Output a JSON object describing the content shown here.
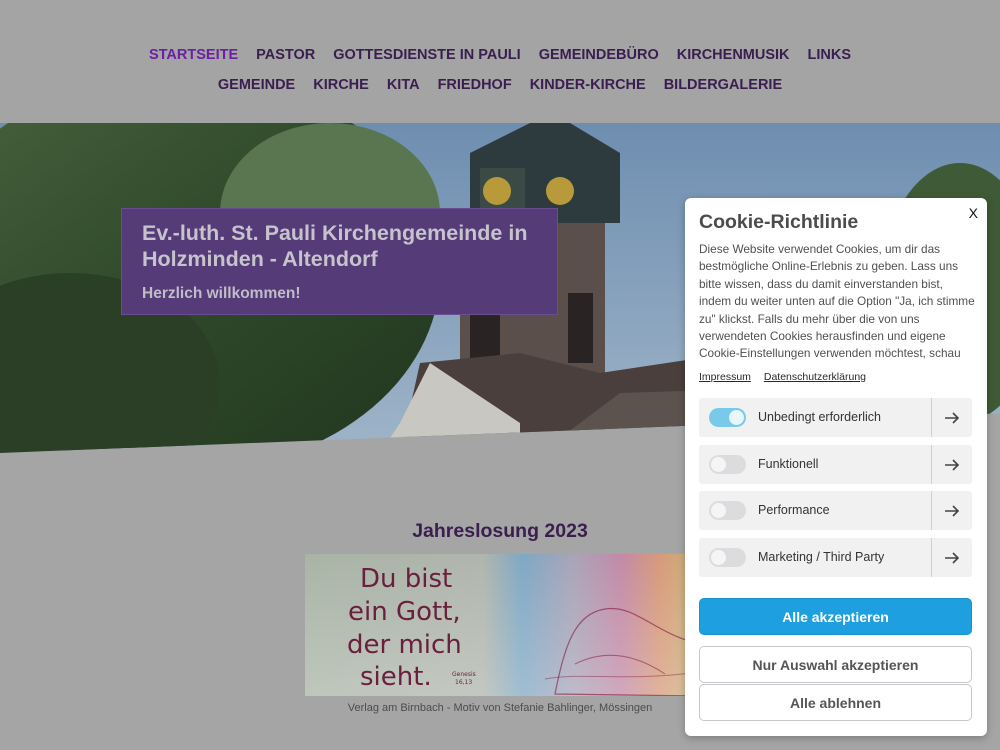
{
  "nav": {
    "row1": [
      {
        "label": "STARTSEITE",
        "active": true
      },
      {
        "label": "PASTOR"
      },
      {
        "label": "GOTTESDIENSTE IN PAULI"
      },
      {
        "label": "GEMEINDEBÜRO"
      },
      {
        "label": "KIRCHENMUSIK"
      },
      {
        "label": "LINKS"
      }
    ],
    "row2": [
      {
        "label": "GEMEINDE"
      },
      {
        "label": "KIRCHE"
      },
      {
        "label": "KITA"
      },
      {
        "label": "FRIEDHOF"
      },
      {
        "label": "KINDER-KIRCHE"
      },
      {
        "label": "BILDERGALERIE"
      }
    ]
  },
  "hero": {
    "title": "Ev.-luth. St. Pauli Kirchengemeinde in Holzminden - Altendorf",
    "subtitle": "Herzlich willkommen!"
  },
  "content": {
    "jahreslosung_title": "Jahreslosung 2023",
    "image_text_lines": [
      "Du bist",
      "ein Gott,",
      "der mich",
      "sieht."
    ],
    "image_reference": [
      "Genesis",
      "16,13"
    ],
    "caption": "Verlag am Birnbach - Motiv von Stefanie Bahlinger, Mössingen"
  },
  "cookie": {
    "close_label": "X",
    "title": "Cookie-Richtlinie",
    "text": "Diese Website verwendet Cookies, um dir das bestmögliche Online-Erlebnis zu geben. Lass uns bitte wissen, dass du damit einverstanden bist, indem du weiter unten auf die Option \"Ja, ich stimme zu\" klickst. Falls du mehr über die von uns verwendeten Cookies herausfinden und eigene Cookie-Einstellungen verwenden möchtest, schau",
    "links": {
      "impressum": "Impressum",
      "datenschutz": "Datenschutzerklärung"
    },
    "categories": [
      {
        "label": "Unbedingt erforderlich",
        "enabled": true
      },
      {
        "label": "Funktionell",
        "enabled": false
      },
      {
        "label": "Performance",
        "enabled": false
      },
      {
        "label": "Marketing / Third Party",
        "enabled": false
      }
    ],
    "buttons": {
      "accept_all": "Alle akzeptieren",
      "accept_selection": "Nur Auswahl akzeptieren",
      "reject_all": "Alle ablehnen"
    },
    "colors": {
      "primary": "#1ea0e0",
      "toggle_on": "#78c9ea"
    }
  }
}
